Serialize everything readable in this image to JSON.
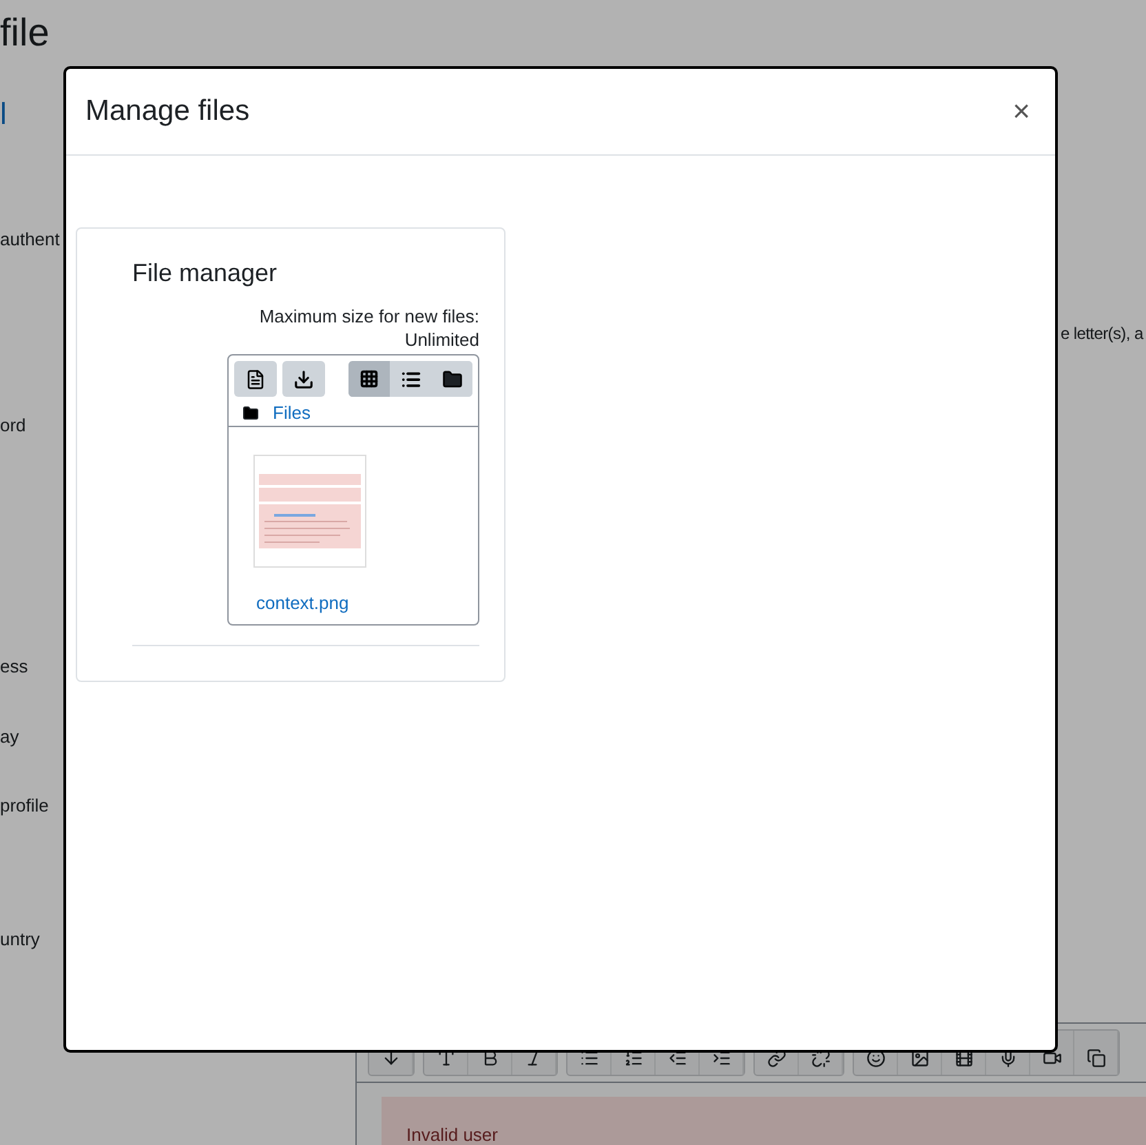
{
  "page": {
    "title": "file",
    "fields": [
      {
        "label": "l",
        "kind": "link"
      },
      {
        "label": "authent",
        "kind": "text"
      },
      {
        "label": "ord",
        "kind": "text"
      },
      {
        "label": "ess",
        "kind": "text"
      },
      {
        "label": "ay",
        "kind": "text"
      },
      {
        "label": "profile",
        "kind": "text"
      },
      {
        "label": "untry",
        "kind": "text"
      }
    ],
    "side_text": "e letter(s), a",
    "editor": {
      "alert": "Invalid user"
    }
  },
  "dialog": {
    "title": "Manage files",
    "close": "×",
    "file_manager": {
      "title": "File manager",
      "max_size": "Maximum size for new files:",
      "max_value": "Unlimited",
      "views": [
        {
          "kind": "grid",
          "selected": true
        },
        {
          "kind": "list",
          "selected": false
        },
        {
          "kind": "tree",
          "selected": false
        }
      ],
      "path": "Files",
      "files": [
        {
          "name": "context.png",
          "kind": "picture"
        }
      ]
    }
  }
}
